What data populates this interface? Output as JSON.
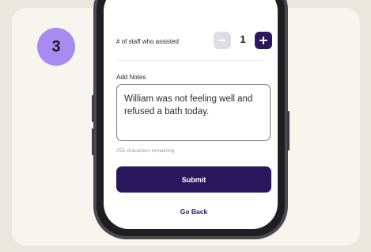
{
  "step": {
    "number": "3"
  },
  "staff": {
    "label": "# of staff who assisted",
    "count": "1",
    "minus_icon": "minus-icon",
    "plus_icon": "plus-icon"
  },
  "notes": {
    "label": "Add Notes",
    "value": "William was not feeling well and refused a bath today.",
    "remaining": "255 characters remaining"
  },
  "actions": {
    "submit_label": "Submit",
    "go_back_label": "Go Back"
  },
  "colors": {
    "background": "#e9e8df",
    "card": "#f6f6ef",
    "badge": "#a88bf0",
    "primary": "#2a175e",
    "disabled": "#dedde6"
  }
}
